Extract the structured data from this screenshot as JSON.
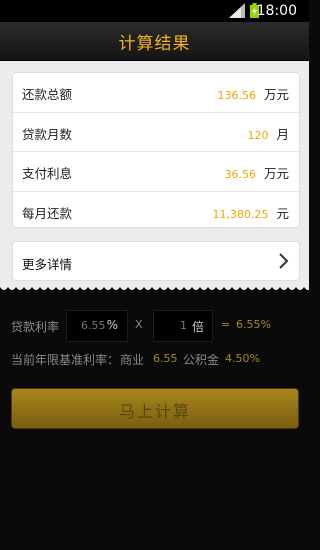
{
  "status": {
    "time": "18:00"
  },
  "header": {
    "title": "计算结果"
  },
  "results": [
    {
      "label": "还款总额",
      "value": "136.56",
      "unit": "万元"
    },
    {
      "label": "贷款月数",
      "value": "120",
      "unit": "月"
    },
    {
      "label": "支付利息",
      "value": "36.56",
      "unit": "万元"
    },
    {
      "label": "每月还款",
      "value": "11,380.25",
      "unit": "元"
    }
  ],
  "details": {
    "label": "更多详情"
  },
  "rate": {
    "label": "贷款利率",
    "base_value": "6.55",
    "base_unit": "%",
    "times_symbol": "X",
    "multiplier_value": "1",
    "multiplier_unit": "倍",
    "equals": "=",
    "result": "6.55%"
  },
  "baseline": {
    "label": "当前年限基准利率：",
    "commercial_label": "商业",
    "commercial_value": "6.55",
    "fund_label": "公积金",
    "fund_value": "4.50%"
  },
  "calc_button": {
    "label": "马上计算"
  },
  "colors": {
    "accent": "#f1a500",
    "title": "#f2b31e"
  }
}
